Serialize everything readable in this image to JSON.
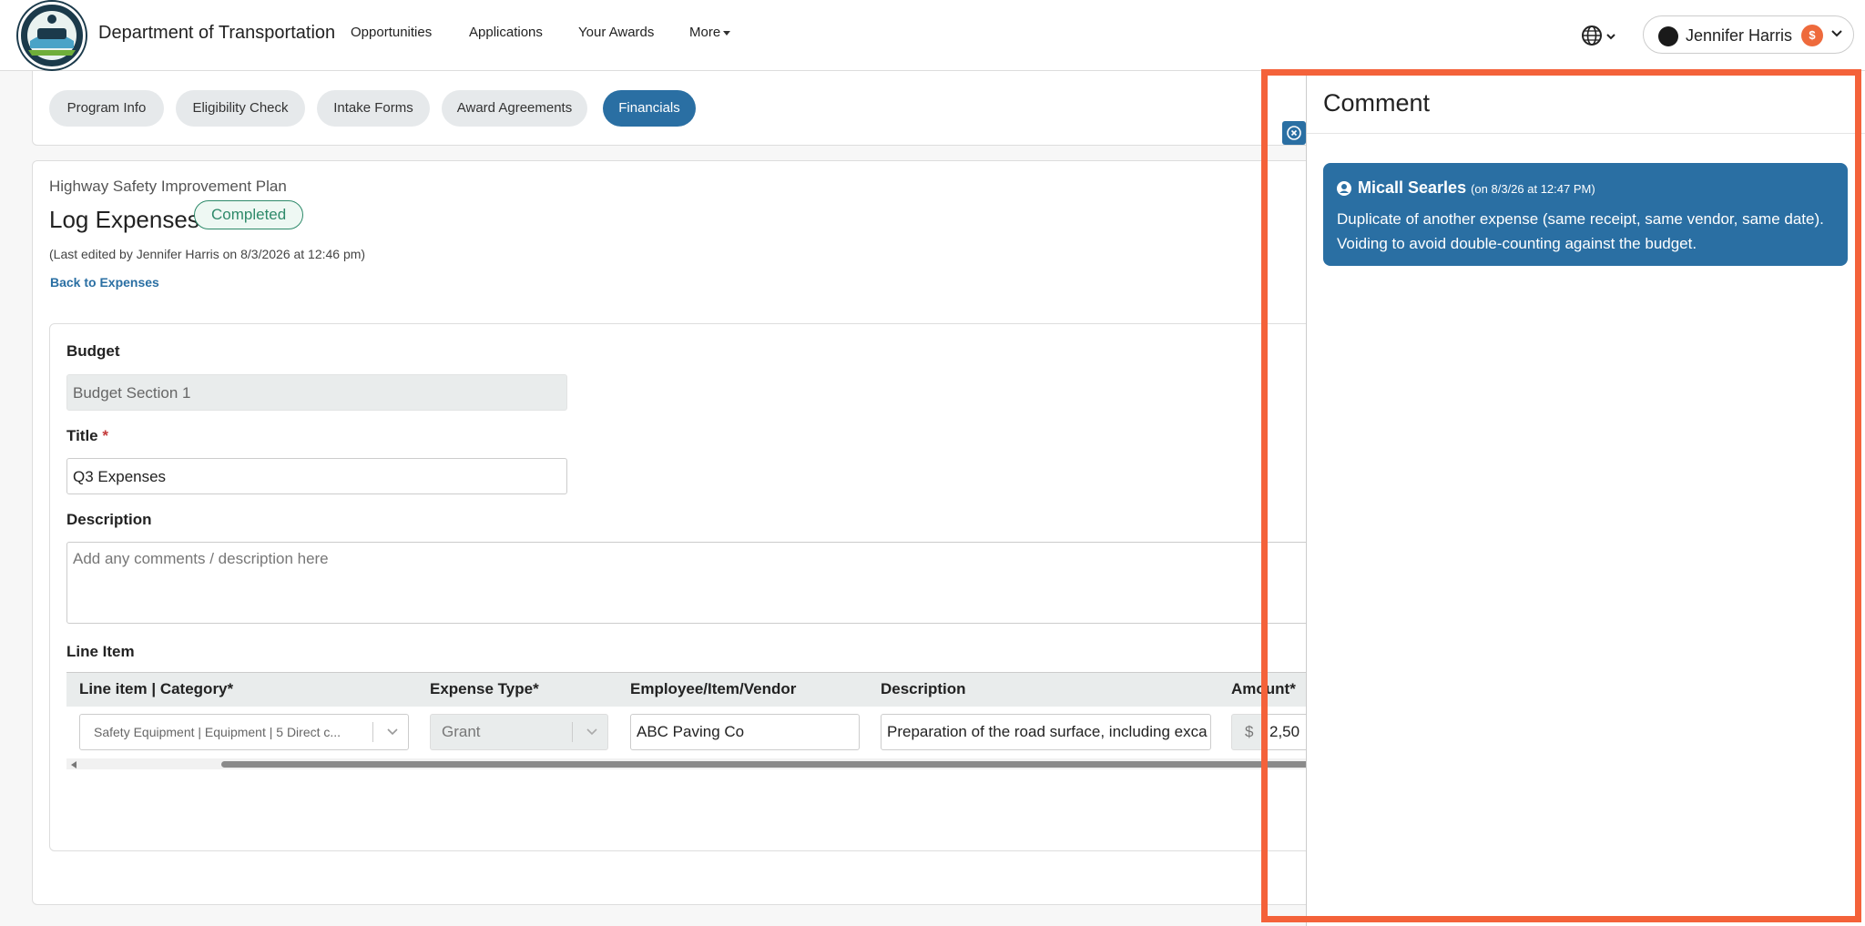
{
  "header": {
    "brand": "Department of Transportation",
    "nav": [
      "Opportunities",
      "Applications",
      "Your Awards",
      "More"
    ],
    "user": {
      "name": "Jennifer Harris",
      "badge": "$"
    }
  },
  "tabs": [
    "Program Info",
    "Eligibility Check",
    "Intake Forms",
    "Award Agreements",
    "Financials"
  ],
  "active_tab": "Financials",
  "page": {
    "program": "Highway Safety Improvement Plan",
    "title": "Log Expenses",
    "status": "Completed",
    "last_edited": "(Last edited by Jennifer Harris on 8/3/2026 at 12:46 pm)",
    "back_link": "Back to Expenses"
  },
  "form": {
    "budget_label": "Budget",
    "budget_value": "Budget Section 1",
    "title_label": "Title",
    "title_required": "*",
    "title_value": "Q3 Expenses",
    "description_label": "Description",
    "description_placeholder": "Add any comments / description here",
    "line_item_label": "Line Item"
  },
  "table": {
    "headers": [
      "Line item | Category*",
      "Expense Type*",
      "Employee/Item/Vendor",
      "Description",
      "Amount*"
    ],
    "row": {
      "category": "Safety Equipment | Equipment | 5 Direct c...",
      "expense_type": "Grant",
      "vendor": "ABC Paving Co",
      "description": "Preparation of the road surface, including exca",
      "currency": "$",
      "amount": "2,50"
    }
  },
  "comment_panel": {
    "title": "Comment",
    "comments": [
      {
        "author": "Micall Searles",
        "date": "(on 8/3/26 at 12:47 PM)",
        "text": "Duplicate of another expense (same receipt, same vendor, same date). Voiding to avoid double-counting against the budget."
      }
    ]
  },
  "colors": {
    "primary": "#2a6fa3",
    "highlight": "#f4623a",
    "status_green": "#2e8a6a"
  }
}
